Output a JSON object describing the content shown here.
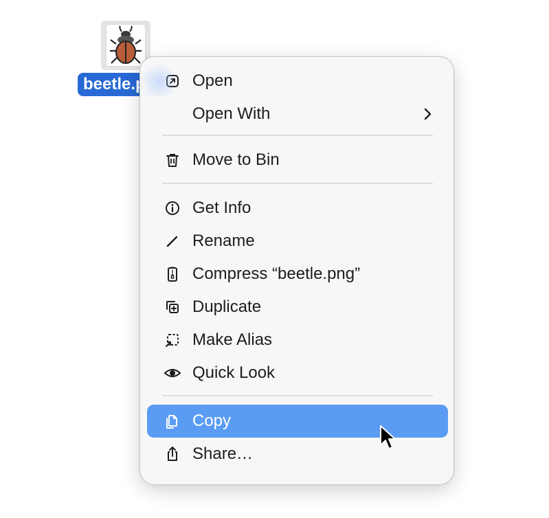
{
  "desktop": {
    "file": {
      "label": "beetle.p",
      "icon": "beetle-image-icon"
    }
  },
  "menu": {
    "selected": "Copy",
    "items": [
      {
        "label": "Open",
        "icon": "open-arrow-icon"
      },
      {
        "label": "Open With",
        "icon": "",
        "submenu": "chevron-right-icon"
      },
      {
        "label": "Move to Bin",
        "icon": "trash-icon"
      },
      {
        "label": "Get Info",
        "icon": "info-icon"
      },
      {
        "label": "Rename",
        "icon": "pencil-icon"
      },
      {
        "label": "Compress “beetle.png”",
        "icon": "zip-archive-icon"
      },
      {
        "label": "Duplicate",
        "icon": "duplicate-icon"
      },
      {
        "label": "Make Alias",
        "icon": "alias-icon"
      },
      {
        "label": "Quick Look",
        "icon": "eye-icon"
      },
      {
        "label": "Copy",
        "icon": "copy-icon"
      },
      {
        "label": "Share…",
        "icon": "share-icon"
      }
    ]
  },
  "colors": {
    "selection": "#5a9cf3",
    "file_label_bg": "#2869d6",
    "beetle_body": "#b85c3a"
  }
}
